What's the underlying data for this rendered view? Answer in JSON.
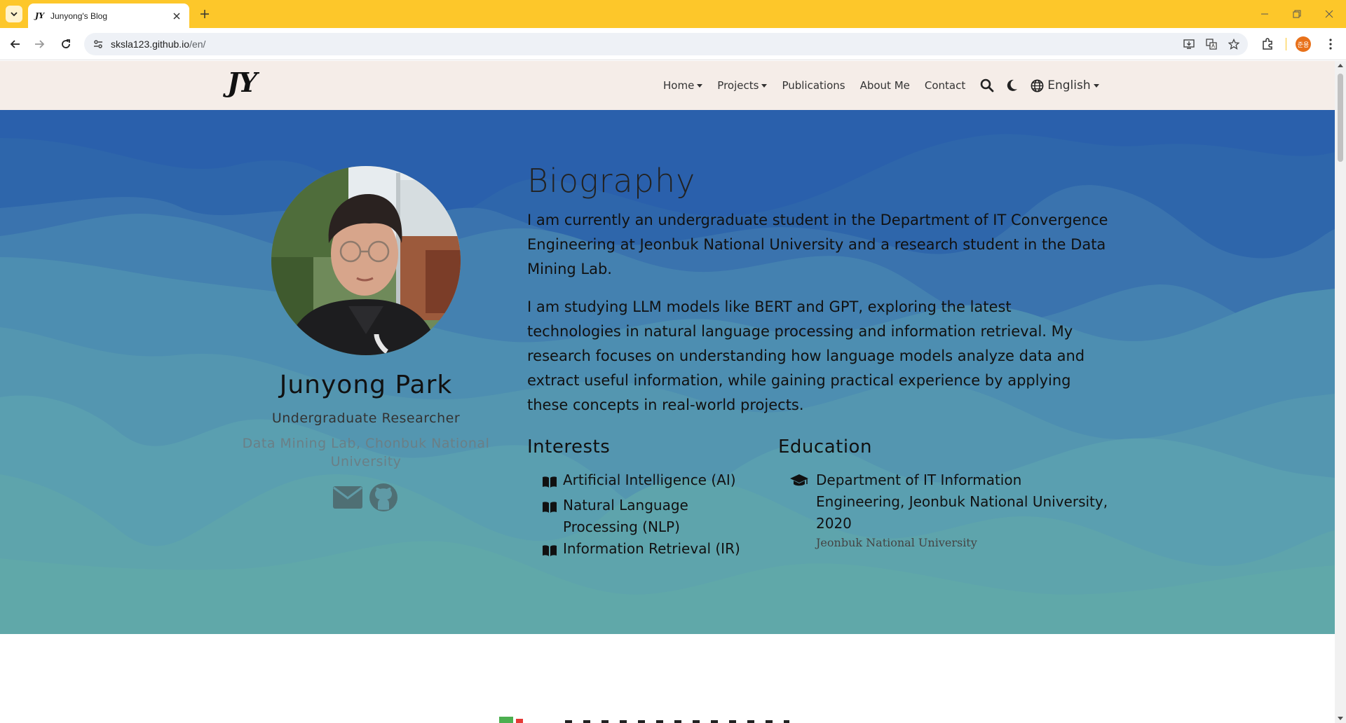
{
  "browser": {
    "tab_title": "Junyong's Blog",
    "tab_favicon": "JY",
    "url_host": "sksla123.github.io",
    "url_path": "/en/",
    "profile_initials": "준용",
    "accent_color": "#fdc72a"
  },
  "nav": {
    "brand": "JY",
    "items": [
      {
        "label": "Home",
        "dropdown": true
      },
      {
        "label": "Projects",
        "dropdown": true
      },
      {
        "label": "Publications",
        "dropdown": false
      },
      {
        "label": "About Me",
        "dropdown": false
      },
      {
        "label": "Contact",
        "dropdown": false
      }
    ],
    "language": "English"
  },
  "profile": {
    "name": "Junyong Park",
    "role": "Undergraduate Researcher",
    "affiliation": "Data Mining Lab, Chonbuk National University"
  },
  "biography": {
    "title": "Biography",
    "paragraphs": [
      "I am currently an undergraduate student in the Department of IT Convergence Engineering at Jeonbuk National University and a research student in the Data Mining Lab.",
      "I am studying LLM models like BERT and GPT, exploring the latest technologies in natural language processing and information retrieval. My research focuses on understanding how language models analyze data and extract useful information, while gaining practical experience by applying these concepts in real-world projects."
    ]
  },
  "interests": {
    "title": "Interests",
    "items": [
      "Artificial Intelligence (AI)",
      "Natural Language Processing (NLP)",
      "Information Retrieval (IR)"
    ]
  },
  "education": {
    "title": "Education",
    "items": [
      {
        "degree": "Department of IT Information Engineering, Jeonbuk National University, 2020",
        "school": "Jeonbuk National University"
      }
    ]
  },
  "colors": {
    "hero_top": "#2a60ac",
    "hero_wave": "#5fa9a8",
    "nav_bg": "#f5ede8"
  }
}
